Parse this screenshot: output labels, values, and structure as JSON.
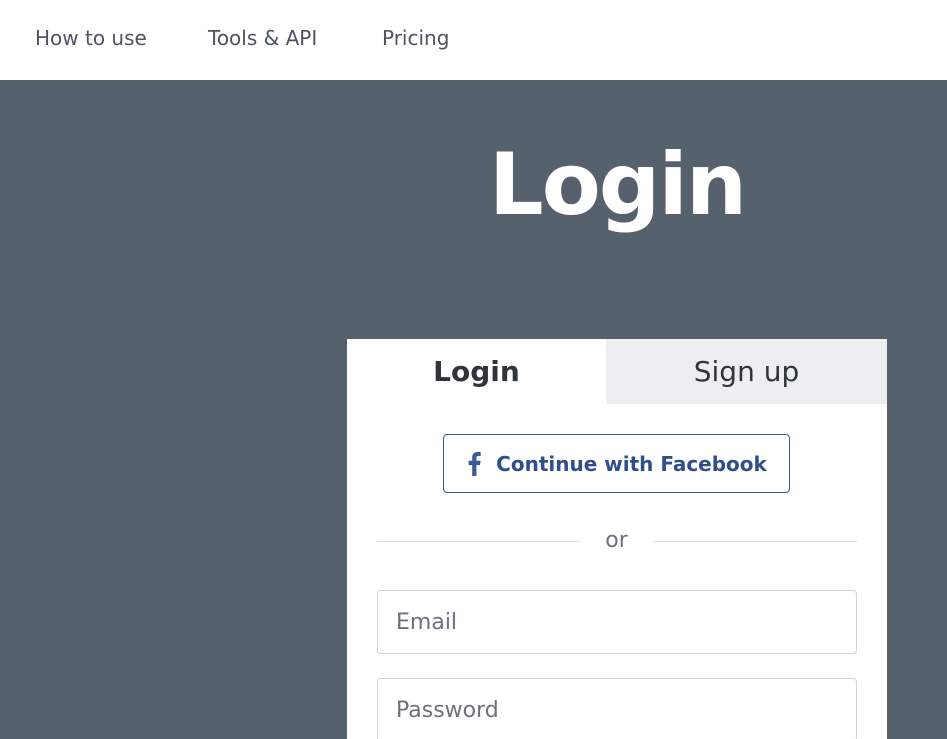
{
  "nav": {
    "items": [
      {
        "label": "How to use"
      },
      {
        "label": "Tools & API"
      },
      {
        "label": "Pricing"
      }
    ]
  },
  "hero": {
    "title": "Login"
  },
  "auth": {
    "tabs": [
      {
        "label": "Login",
        "active": true
      },
      {
        "label": "Sign up",
        "active": false
      }
    ],
    "facebook_button": {
      "label": "Continue with Facebook",
      "icon": "facebook-icon",
      "color": "#3b5a97"
    },
    "divider_text": "or",
    "email": {
      "placeholder": "Email",
      "value": ""
    },
    "password": {
      "placeholder": "Password",
      "value": ""
    }
  },
  "colors": {
    "background": "#56616d",
    "facebook": "#3b5a97",
    "tab_inactive": "#eceef0"
  }
}
